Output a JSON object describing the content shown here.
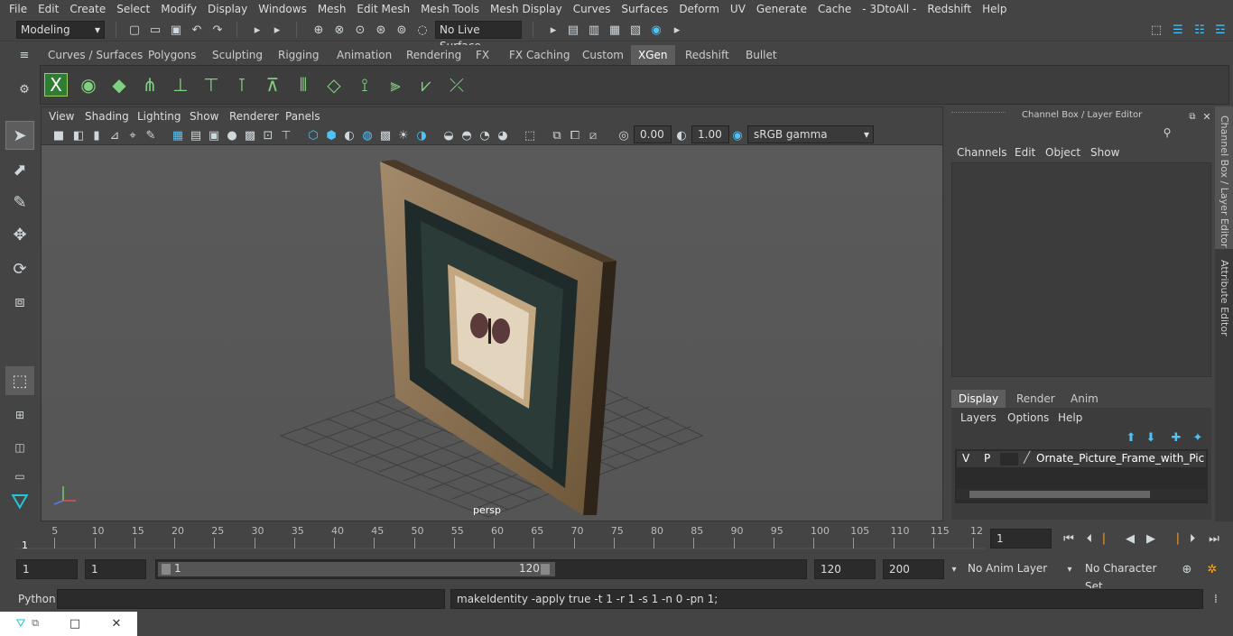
{
  "menu": [
    "File",
    "Edit",
    "Create",
    "Select",
    "Modify",
    "Display",
    "Windows",
    "Mesh",
    "Edit Mesh",
    "Mesh Tools",
    "Mesh Display",
    "Curves",
    "Surfaces",
    "Deform",
    "UV",
    "Generate",
    "Cache",
    "- 3DtoAll -",
    "Redshift",
    "Help"
  ],
  "status": {
    "mode": "Modeling",
    "live_surface": "No Live Surface"
  },
  "shelf_tabs": [
    "Curves / Surfaces",
    "Polygons",
    "Sculpting",
    "Rigging",
    "Animation",
    "Rendering",
    "FX",
    "FX Caching",
    "Custom",
    "XGen",
    "Redshift",
    "Bullet"
  ],
  "active_shelf_tab": "XGen",
  "viewport": {
    "menu": [
      "View",
      "Shading",
      "Lighting",
      "Show",
      "Renderer",
      "Panels"
    ],
    "exposure": "0.00",
    "gamma": "1.00",
    "color_space": "sRGB gamma",
    "camera_label": "persp"
  },
  "channel_box": {
    "title": "Channel Box / Layer Editor",
    "menu": [
      "Channels",
      "Edit",
      "Object",
      "Show"
    ],
    "layer_tabs": [
      "Display",
      "Render",
      "Anim"
    ],
    "active_layer_tab": "Display",
    "layer_menu": [
      "Layers",
      "Options",
      "Help"
    ],
    "layer": {
      "v": "V",
      "p": "P",
      "name": "Ornate_Picture_Frame_with_Picture_C"
    }
  },
  "side_tabs": [
    "Channel Box / Layer Editor",
    "Attribute Editor"
  ],
  "timeline": {
    "ticks": [
      "5",
      "10",
      "15",
      "20",
      "25",
      "30",
      "35",
      "40",
      "45",
      "50",
      "55",
      "60",
      "65",
      "70",
      "75",
      "80",
      "85",
      "90",
      "95",
      "100",
      "105",
      "110",
      "115",
      "12"
    ],
    "start_label": "1",
    "current_frame": "1"
  },
  "range": {
    "start": "1",
    "start2": "1",
    "slider_start": "1",
    "slider_end": "120",
    "end": "120",
    "end2": "200",
    "anim_layer": "No Anim Layer",
    "char_set": "No Character Set"
  },
  "cmd": {
    "lang": "Python",
    "output": "makeIdentity -apply true -t 1 -r 1 -s 1 -n 0 -pn 1;"
  }
}
